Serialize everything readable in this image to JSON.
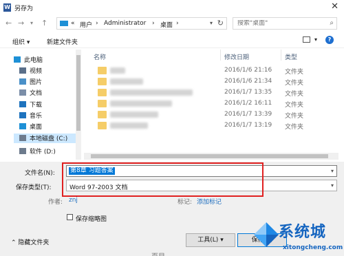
{
  "window": {
    "title": "另存为",
    "close_glyph": "✕"
  },
  "address_bar": {
    "crumbs": [
      "«",
      "用户",
      "›",
      "Administrator",
      "›",
      "桌面",
      "›"
    ]
  },
  "search": {
    "placeholder": "搜索\"桌面\""
  },
  "toolbar": {
    "organize_label": "组织 ▾",
    "new_folder_label": "新建文件夹"
  },
  "sidebar": {
    "items": [
      {
        "label": "此电脑",
        "icon": "pc-icon",
        "color": "#1e90d6"
      },
      {
        "label": "视频",
        "icon": "video-icon",
        "color": "#5a6f8a"
      },
      {
        "label": "图片",
        "icon": "pictures-icon",
        "color": "#4a90c8"
      },
      {
        "label": "文档",
        "icon": "documents-icon",
        "color": "#7b8ea8"
      },
      {
        "label": "下载",
        "icon": "download-icon",
        "color": "#1e73be"
      },
      {
        "label": "音乐",
        "icon": "music-icon",
        "color": "#1e73be"
      },
      {
        "label": "桌面",
        "icon": "desktop-icon",
        "color": "#1e90d6"
      },
      {
        "label": "本地磁盘 (C:)",
        "icon": "drive-icon",
        "color": "#6d7b8d",
        "selected": true
      },
      {
        "label": "软件 (D:)",
        "icon": "drive-icon",
        "color": "#6d7b8d"
      }
    ]
  },
  "file_list": {
    "columns": [
      "名称",
      "修改日期",
      "类型"
    ],
    "rows": [
      {
        "date": "2016/1/6 21:16",
        "type": "文件夹"
      },
      {
        "date": "2016/1/6 21:34",
        "type": "文件夹"
      },
      {
        "date": "2016/1/7 13:35",
        "type": "文件夹"
      },
      {
        "date": "2016/1/2 16:11",
        "type": "文件夹"
      },
      {
        "date": "2016/1/7 13:39",
        "type": "文件夹"
      },
      {
        "date": "2016/1/7 13:19",
        "type": "文件夹"
      }
    ]
  },
  "form": {
    "file_name_label": "文件名(N):",
    "file_name_value": "第8章 习题答案",
    "save_type_label": "保存类型(T):",
    "save_type_value": "Word 97-2003 文档",
    "author_label": "作者:",
    "author_value": "znj",
    "tags_label": "标记:",
    "tags_value": "添加标记",
    "thumbnail_label": "保存缩略图"
  },
  "footer": {
    "hide_folders_label": "隐藏文件夹",
    "tools_label": "工具(L)",
    "save_label": "保存(S)"
  },
  "watermark": {
    "cn": "系统城",
    "en": "xitongcheng.com"
  },
  "background_partial_text": "页目",
  "colors": {
    "accent": "#0078d7",
    "highlight_box": "#e02020",
    "folder": "#f5cd68"
  }
}
